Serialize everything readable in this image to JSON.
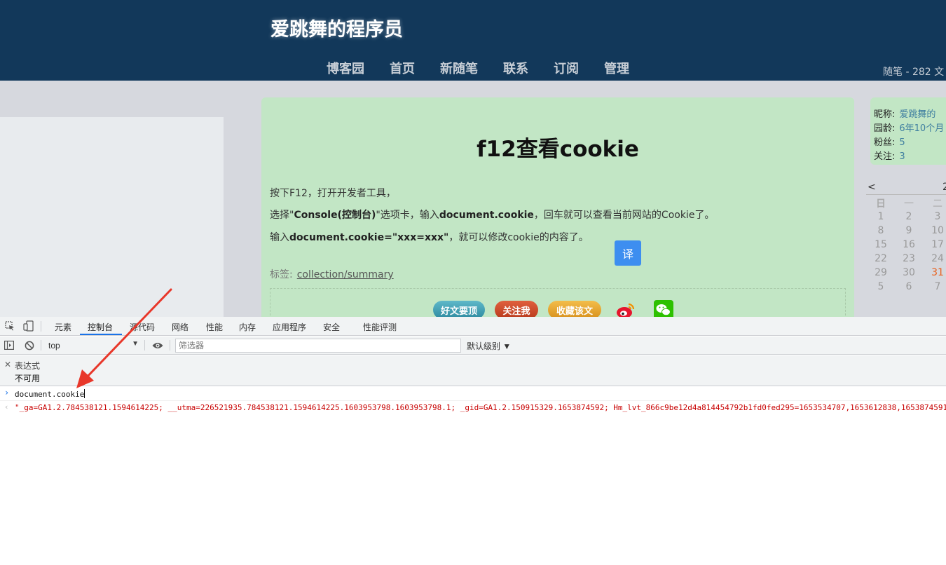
{
  "blog": {
    "title": "爱跳舞的程序员",
    "nav": [
      "博客园",
      "首页",
      "新随笔",
      "联系",
      "订阅",
      "管理"
    ],
    "stats": "随笔 - 282  文"
  },
  "post": {
    "title": "f12查看cookie",
    "p1": "按下F12，打开开发者工具，",
    "p2_a": "选择\"",
    "p2_b": "Console(控制台)",
    "p2_c": "\"选项卡，输入",
    "p2_d": "document.cookie",
    "p2_e": "，回车就可以查看当前网站的Cookie了。",
    "p3_a": "输入",
    "p3_b": "document.cookie=\"xxx=xxx\"",
    "p3_c": "，就可以修改cookie的内容了。",
    "translate_label": "译",
    "tags_label": "标签:",
    "tag": "collection/summary",
    "digg_label": "好文要顶",
    "follow_label": "关注我",
    "fav_label": "收藏该文"
  },
  "profile": {
    "nick_k": "昵称:",
    "nick_v": "爱跳舞的",
    "age_k": "园龄:",
    "age_v": "6年10个月",
    "fans_k": "粉丝:",
    "fans_v": "5",
    "follow_k": "关注:",
    "follow_v": "3"
  },
  "calendar": {
    "prev": "<",
    "month": "2",
    "weekdays": [
      "日",
      "一",
      "二"
    ],
    "rows": [
      [
        "1",
        "2",
        "3"
      ],
      [
        "8",
        "9",
        "10"
      ],
      [
        "15",
        "16",
        "17"
      ],
      [
        "22",
        "23",
        "24"
      ],
      [
        "29",
        "30",
        "31"
      ],
      [
        "5",
        "6",
        "7"
      ]
    ],
    "highlight_color": "#e8601c"
  },
  "devtools": {
    "tabs": [
      "元素",
      "控制台",
      "源代码",
      "网络",
      "性能",
      "内存",
      "应用程序",
      "安全",
      "性能评测"
    ],
    "active_tab": "控制台",
    "context": "top",
    "filter_placeholder": "筛选器",
    "level": "默认级别 ▼",
    "expression_label": "表达式",
    "expression_value": "不可用",
    "input": "document.cookie",
    "result": "\"_ga=GA1.2.784538121.1594614225; __utma=226521935.784538121.1594614225.1603953798.1603953798.1; _gid=GA1.2.150915329.1653874592; Hm_lvt_866c9be12d4a814454792b1fd0fed295=1653534707,1653612838,1653874591,"
  },
  "colors": {
    "header": "#12385a",
    "post_bg": "#c2e6c5",
    "accent": "#1a73e8",
    "arrow": "#e8372a"
  }
}
